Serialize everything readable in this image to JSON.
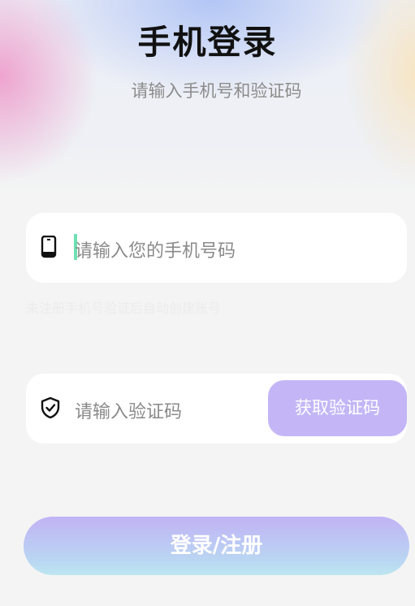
{
  "header": {
    "title": "手机登录",
    "subtitle": "请输入手机号和验证码"
  },
  "phone_field": {
    "icon": "phone-icon",
    "placeholder": "请输入您的手机号码",
    "hint": "未注册手机号验证后自动创建账号"
  },
  "code_field": {
    "icon": "shield-check-icon",
    "placeholder": "请输入验证码",
    "button_label": "获取验证码"
  },
  "actions": {
    "login_label": "登录/注册"
  },
  "colors": {
    "accent": "#c4b6f6",
    "caret": "#6fe0b4",
    "background": "#f4f4f4"
  }
}
